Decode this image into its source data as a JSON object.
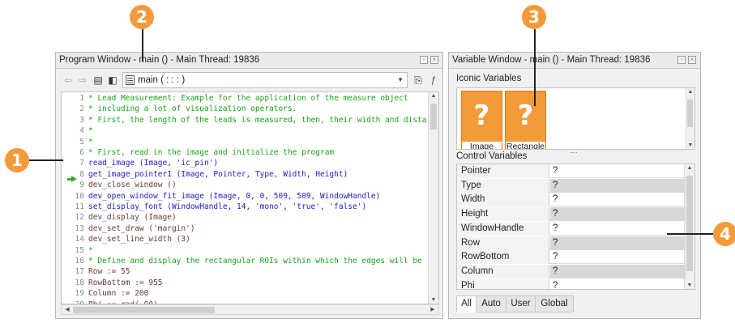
{
  "program_window": {
    "title": "Program Window - main () - Main Thread: 19836",
    "procedure": "main ( : : : )",
    "lines": [
      {
        "n": "1",
        "text": "* Lead Measurement: Example for the application of the measure object",
        "kind": "cmt"
      },
      {
        "n": "2",
        "text": "* including a lot of visualization operators.",
        "kind": "cmt"
      },
      {
        "n": "3",
        "text": "* First, the length of the leads is measured, then, their width and distance f",
        "kind": "cmt"
      },
      {
        "n": "4",
        "text": "*",
        "kind": "cmt"
      },
      {
        "n": "5",
        "text": "*",
        "kind": "cmt"
      },
      {
        "n": "6",
        "text": "* First, read in the image and initialize the program",
        "kind": "cmt"
      },
      {
        "n": "7",
        "text": "read_image (Image, 'ic_pin')",
        "kind": "op"
      },
      {
        "n": "8",
        "text": "get_image_pointer1 (Image, Pointer, Type, Width, Height)",
        "kind": "op"
      },
      {
        "n": "9",
        "text": "dev_close_window ()",
        "kind": "as"
      },
      {
        "n": "10",
        "text": "dev_open_window_fit_image (Image, 0, 0, 509, 509, WindowHandle)",
        "kind": "op"
      },
      {
        "n": "11",
        "text": "set_display_font (WindowHandle, 14, 'mono', 'true', 'false')",
        "kind": "op"
      },
      {
        "n": "12",
        "text": "dev_display (Image)",
        "kind": "as"
      },
      {
        "n": "13",
        "text": "dev_set_draw ('margin')",
        "kind": "as"
      },
      {
        "n": "14",
        "text": "dev_set_line_width (3)",
        "kind": "as"
      },
      {
        "n": "15",
        "text": "*",
        "kind": "cmt"
      },
      {
        "n": "16",
        "text": "* Define and display the rectangular ROIs within which the edges will be detec",
        "kind": "cmt"
      },
      {
        "n": "17",
        "text": "Row := 55",
        "kind": "as"
      },
      {
        "n": "18",
        "text": "RowBottom := 955",
        "kind": "as"
      },
      {
        "n": "19",
        "text": "Column := 200",
        "kind": "as"
      },
      {
        "n": "20",
        "text": "Phi := rad(-90)",
        "kind": "as"
      }
    ]
  },
  "variable_window": {
    "title": "Variable Window - main () - Main Thread: 19836",
    "iconic_label": "Iconic Variables",
    "iconic": [
      {
        "name": "Image",
        "glyph": "?"
      },
      {
        "name": "Rectangle",
        "glyph": "?"
      }
    ],
    "control_label": "Control Variables",
    "control": [
      {
        "name": "Pointer",
        "value": "?"
      },
      {
        "name": "Type",
        "value": "?"
      },
      {
        "name": "Width",
        "value": "?"
      },
      {
        "name": "Height",
        "value": "?"
      },
      {
        "name": "WindowHandle",
        "value": "?"
      },
      {
        "name": "Row",
        "value": "?"
      },
      {
        "name": "RowBottom",
        "value": "?"
      },
      {
        "name": "Column",
        "value": "?"
      },
      {
        "name": "Phi",
        "value": "?"
      }
    ],
    "tabs": [
      "All",
      "Auto",
      "User",
      "Global"
    ],
    "active_tab": "All"
  },
  "callouts": [
    "1",
    "2",
    "3",
    "4"
  ],
  "colors": {
    "callout": "#f39a3a",
    "comment": "#17a517",
    "operator": "#2020c0",
    "pc_arrow": "#3aa83a"
  }
}
